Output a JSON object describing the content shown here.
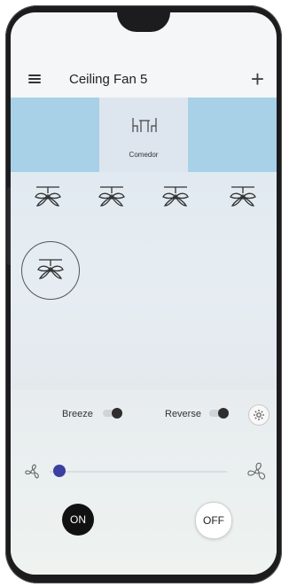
{
  "app": {
    "title": "Ceiling Fan 5"
  },
  "rooms": [
    {
      "name": "",
      "selected": false
    },
    {
      "name": "Comedor",
      "selected": true,
      "icon": "dining-table-icon"
    },
    {
      "name": "",
      "selected": false
    }
  ],
  "fans": [
    {
      "icon": "ceiling-fan-icon",
      "selected": false
    },
    {
      "icon": "ceiling-fan-icon",
      "selected": false
    },
    {
      "icon": "ceiling-fan-icon",
      "selected": false
    },
    {
      "icon": "ceiling-fan-icon",
      "selected": false
    },
    {
      "icon": "ceiling-fan-icon",
      "selected": true
    }
  ],
  "controls": {
    "breeze_label": "Breeze",
    "breeze_on": false,
    "reverse_label": "Reverse",
    "reverse_on": false,
    "speed_level": 0.05,
    "on_label": "ON",
    "off_label": "OFF"
  },
  "colors": {
    "room_inactive": "#a8d0e6",
    "room_active": "#dde6ee",
    "slider_knob": "#3b3fa0",
    "on_button": "#111111"
  }
}
